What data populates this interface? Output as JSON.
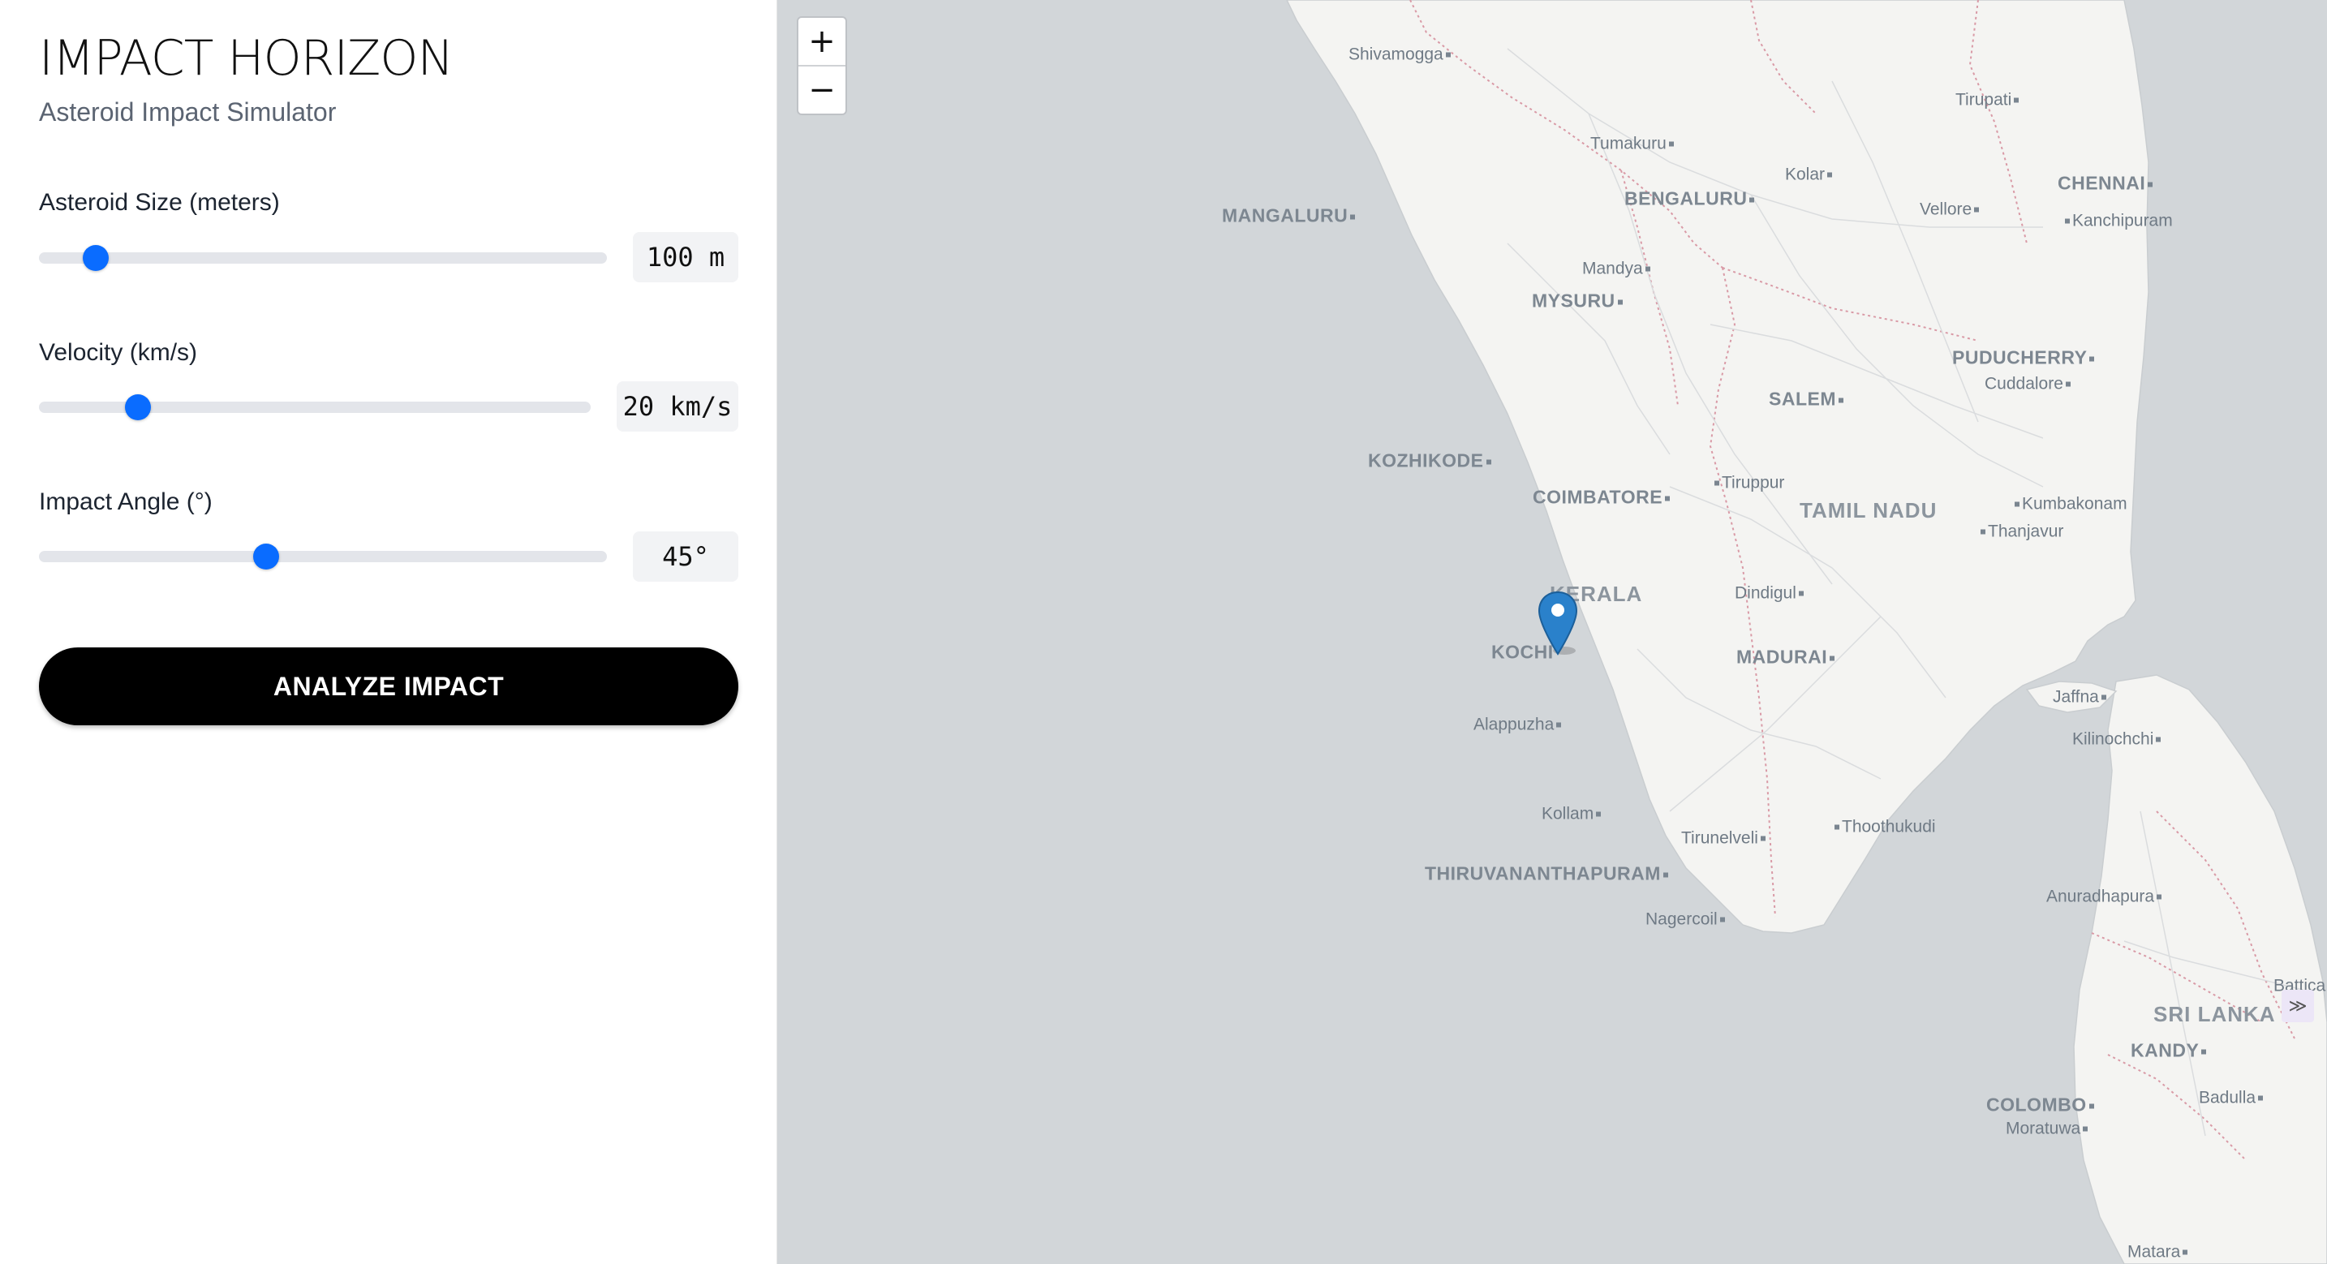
{
  "app": {
    "title": "IMPACT HORIZON",
    "subtitle": "Asteroid Impact Simulator"
  },
  "controls": [
    {
      "label": "Asteroid Size (meters)",
      "value_text": "100 m",
      "level": 0.1
    },
    {
      "label": "Velocity (km/s)",
      "value_text": "20 km/s",
      "level": 0.18
    },
    {
      "label": "Impact Angle (°)",
      "value_text": "45°",
      "level": 0.4
    }
  ],
  "analyze_button": {
    "label": "ANALYZE IMPACT"
  },
  "map": {
    "zoom_in_label": "+",
    "zoom_out_label": "−",
    "attribution_icon": "expand-icon",
    "labels": {
      "shivamogga": "Shivamogga",
      "tirupati": "Tirupati",
      "tumakuru": "Tumakuru",
      "kolar": "Kolar",
      "bengaluru": "BENGALURU",
      "chennai": "CHENNAI",
      "vellore": "Vellore",
      "kanchipuram": "Kanchipuram",
      "mangaluru": "MANGALURU",
      "mandya": "Mandya",
      "mysuru": "MYSURU",
      "puducherry": "PUDUCHERRY",
      "cuddalore": "Cuddalore",
      "salem": "SALEM",
      "kozhikode": "KOZHIKODE",
      "tiruppur": "Tiruppur",
      "coimbatore": "COIMBATORE",
      "tamil_nadu": "TAMIL NADU",
      "kumbakonam": "Kumbakonam",
      "thanjavur": "Thanjavur",
      "kerala": "KERALA",
      "dindigul": "Dindigul",
      "kochi": "KOCHI",
      "madurai": "MADURAI",
      "jaffna": "Jaffna",
      "kilinochchi": "Kilinochchi",
      "alappuzha": "Alappuzha",
      "kollam": "Kollam",
      "thoothukudi": "Thoothukudi",
      "tirunelveli": "Tirunelveli",
      "thiruvananthapuram": "THIRUVANANTHAPURAM",
      "nagercoil": "Nagercoil",
      "anuradhapura": "Anuradhapura",
      "batticaloa": "Battica",
      "sri_lanka": "SRI LANKA",
      "kandy": "KANDY",
      "badulla": "Badulla",
      "colombo": "COLOMBO",
      "moratuwa": "Moratuwa",
      "matara": "Matara"
    },
    "colors": {
      "water": "#d2d6d9",
      "land": "#f4f4f2",
      "marker": "#2a81cb",
      "border": "#d99aa6"
    }
  }
}
